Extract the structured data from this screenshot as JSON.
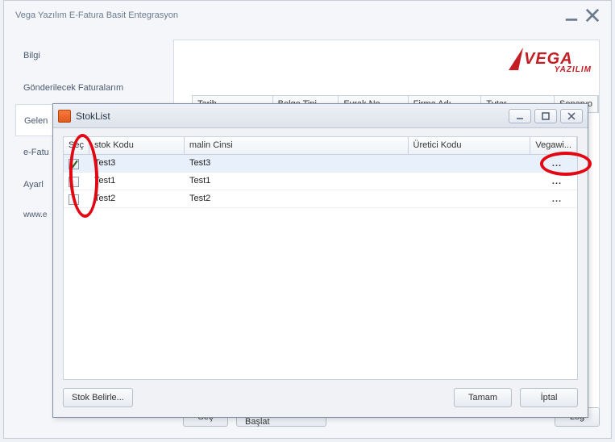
{
  "main": {
    "title": "Vega Yazılım E-Fatura Basit Entegrasyon",
    "tabs": [
      {
        "label": "Bilgi"
      },
      {
        "label": "Gönderilecek Faturalarım"
      },
      {
        "label": "Gelen"
      },
      {
        "label": "e-Fatu"
      },
      {
        "label": "Ayarl"
      }
    ],
    "site": "www.e",
    "parentGrid": {
      "cols": [
        "Tarih",
        "Belge Tipi",
        "Evrak No",
        "Firma Adı",
        "Tutar",
        "Senaryo"
      ]
    },
    "buttons": {
      "sec": "Seç",
      "entegrasyon": "Entegrasyon Başlat",
      "log": "Log"
    },
    "logo": {
      "big": "VEGA",
      "sub": "YAZILIM"
    }
  },
  "dialog": {
    "title": "StokList",
    "cols": {
      "sec": "Seç",
      "kod": "stok Kodu",
      "cinsi": "malin Cinsi",
      "uretici": "Üretici Kodu",
      "vega": "Vegawi..."
    },
    "rows": [
      {
        "checked": true,
        "kod": "Test3",
        "cinsi": "Test3",
        "uretici": "",
        "dots": "..."
      },
      {
        "checked": false,
        "kod": "Test1",
        "cinsi": "Test1",
        "uretici": "",
        "dots": "..."
      },
      {
        "checked": false,
        "kod": "Test2",
        "cinsi": "Test2",
        "uretici": "",
        "dots": "..."
      }
    ],
    "buttons": {
      "stok": "Stok Belirle...",
      "tamam": "Tamam",
      "iptal": "İptal"
    }
  }
}
